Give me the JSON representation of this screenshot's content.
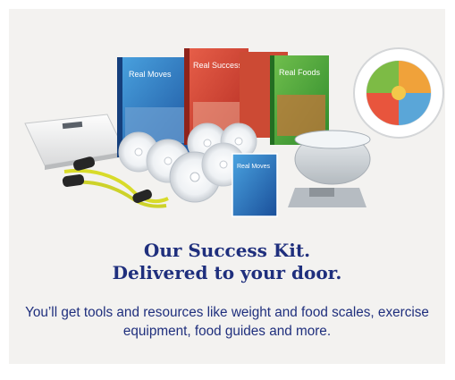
{
  "promo": {
    "headline_line1": "Our Success Kit.",
    "headline_line2": "Delivered to your door.",
    "body": "You’ll get tools and resources like weight and food scales, exercise equipment, food guides and more."
  },
  "products": {
    "book_real_moves_title": "Real Moves",
    "book_success_guide_title": "Real Success Guide",
    "book_real_foods_title": "Real Foods",
    "dvd_case_title": "Real Moves"
  },
  "colors": {
    "text_navy": "#1f2f7d",
    "card_bg": "#f3f2f0"
  }
}
